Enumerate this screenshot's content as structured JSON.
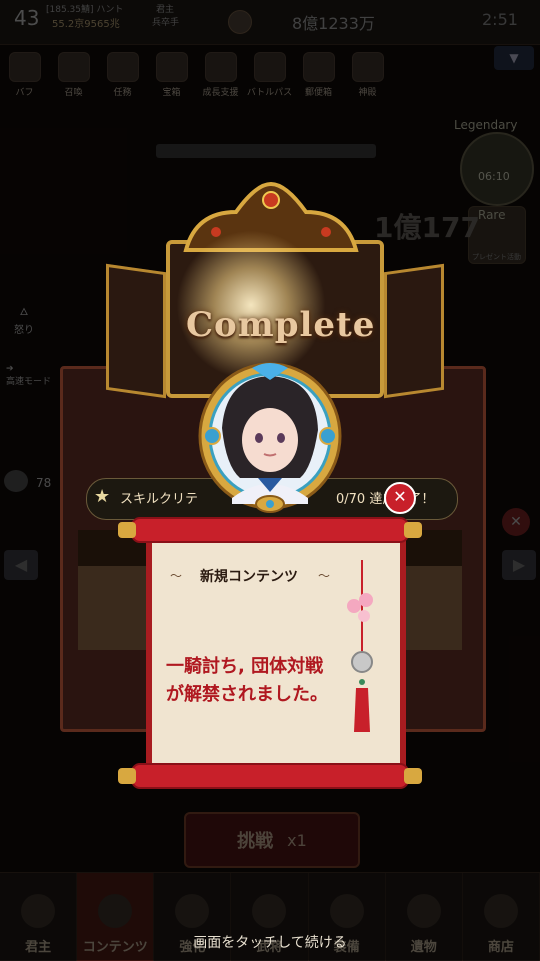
{
  "player": {
    "level": "43",
    "name": "[185.35鯖] ハント",
    "power": "55.2京9565兆",
    "rank_label": "君主",
    "rank_value": "兵卒手"
  },
  "gold": "8億1233万",
  "clock": "2:51",
  "top_icons": [
    {
      "label": "バフ",
      "icon": "buff-icon"
    },
    {
      "label": "召喚",
      "icon": "summon-icon"
    },
    {
      "label": "任務",
      "icon": "mission-icon"
    },
    {
      "label": "宝箱",
      "icon": "treasure-icon"
    },
    {
      "label": "成長支援",
      "icon": "growth-icon"
    },
    {
      "label": "バトルパス",
      "icon": "battlepass-icon"
    },
    {
      "label": "郵便箱",
      "icon": "mail-icon"
    },
    {
      "label": "神殿",
      "icon": "temple-icon"
    }
  ],
  "legendary": {
    "label": "Legendary",
    "time": "06:10"
  },
  "rare": {
    "label": "Rare",
    "sub": "プレゼント活動"
  },
  "big_number": "1億177",
  "side": {
    "rage_label": "怒り",
    "mode_label": "高速モード"
  },
  "chat_count": "78",
  "banner": {
    "text": "Complete"
  },
  "quest": {
    "text_left": "スキルクリテ",
    "text_right": "0/70 達成完了！",
    "star_icon": "star-icon"
  },
  "scroll": {
    "title": "新規コンテンツ",
    "line1": "一騎討ち, 団体対戦",
    "line2": "が解禁されました。"
  },
  "challenge": {
    "label": "挑戦",
    "count": "x1"
  },
  "bottom_nav": [
    {
      "label": "君主"
    },
    {
      "label": "コンテンツ"
    },
    {
      "label": "強化"
    },
    {
      "label": "武将"
    },
    {
      "label": "装備"
    },
    {
      "label": "遺物"
    },
    {
      "label": "商店"
    }
  ],
  "touch_hint": "画面をタッチして続ける",
  "colors": {
    "scroll_red": "#a81c20",
    "gold_frame": "#c89a3a",
    "text_red": "#b01820",
    "close_red": "#c8202a"
  }
}
